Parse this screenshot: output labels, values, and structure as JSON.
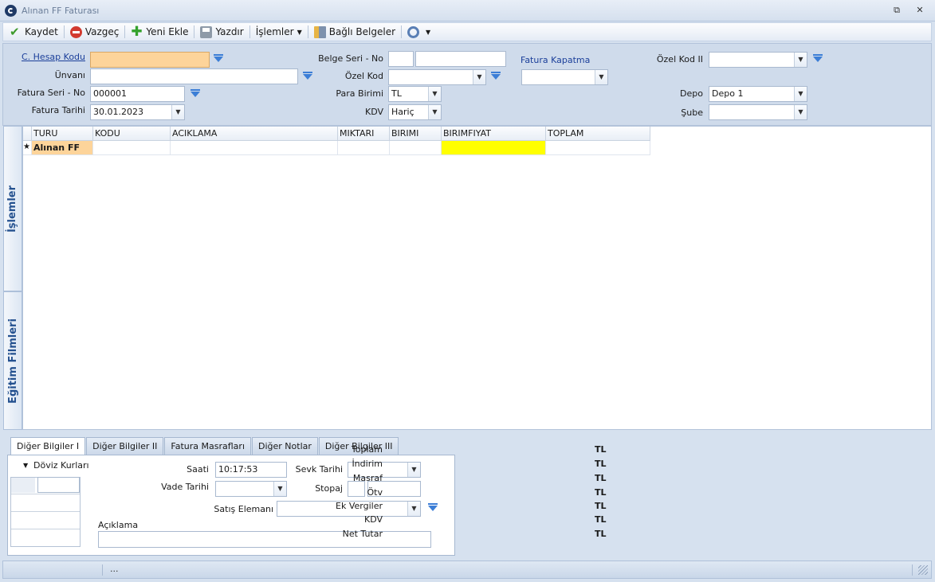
{
  "window": {
    "title": "Alınan FF Faturası"
  },
  "toolbar": {
    "save": "Kaydet",
    "cancel": "Vazgeç",
    "new": "Yeni Ekle",
    "print": "Yazdır",
    "operations": "İşlemler",
    "linked_docs": "Bağlı Belgeler"
  },
  "header": {
    "account_code_label": "C. Hesap Kodu",
    "account_code_value": "",
    "title_label": "Ünvanı",
    "title_value": "",
    "invoice_serial_label": "Fatura Seri - No",
    "invoice_serial_value": "000001",
    "invoice_date_label": "Fatura Tarihi",
    "invoice_date_value": "30.01.2023",
    "doc_serial_label": "Belge Seri - No",
    "doc_serial_value1": "",
    "doc_serial_value2": "",
    "special_code_label": "Özel Kod",
    "special_code_value": "",
    "currency_label": "Para Birimi",
    "currency_value": "TL",
    "vat_label": "KDV",
    "vat_value": "Hariç",
    "invoice_closing_label": "Fatura Kapatma",
    "invoice_closing_value": "",
    "special_code2_label": "Özel Kod II",
    "special_code2_value": "",
    "warehouse_label": "Depo",
    "warehouse_value": "Depo 1",
    "branch_label": "Şube",
    "branch_value": ""
  },
  "sidetabs": {
    "operations": "İşlemler",
    "training": "Eğitim Filmleri"
  },
  "grid": {
    "columns": [
      "TURU",
      "KODU",
      "ACIKLAMA",
      "MIKTARI",
      "BIRIMI",
      "BIRIMFIYAT",
      "TOPLAM"
    ],
    "new_row_marker": "★",
    "new_row_type": "Alınan FF"
  },
  "bottom": {
    "tabs": [
      "Diğer Bilgiler I",
      "Diğer Bilgiler II",
      "Fatura Masrafları",
      "Diğer Notlar",
      "Diğer Bilgiler III"
    ],
    "active_tab": "Diğer Bilgiler I",
    "exchange_rates": "Döviz Kurları",
    "time_label": "Saati",
    "time_value": "10:17:53",
    "due_date_label": "Vade Tarihi",
    "shipping_date_label": "Sevk Tarihi",
    "stoppage_label": "Stopaj",
    "sales_rep_label": "Satış Elemanı",
    "description_label": "Açıklama"
  },
  "totals": [
    {
      "label": "Toplam",
      "unit": "TL"
    },
    {
      "label": "İndirim",
      "unit": "TL"
    },
    {
      "label": "Masraf",
      "unit": "TL"
    },
    {
      "label": "Ötv",
      "unit": "TL"
    },
    {
      "label": "Ek Vergiler",
      "unit": "TL"
    },
    {
      "label": "KDV",
      "unit": "TL"
    },
    {
      "label": "Net Tutar",
      "unit": "TL"
    }
  ],
  "status": {
    "text": "..."
  },
  "colors": {
    "required_field": "#fdd49a",
    "price_cell": "#ffff00",
    "accent": "#3c7ed6"
  }
}
